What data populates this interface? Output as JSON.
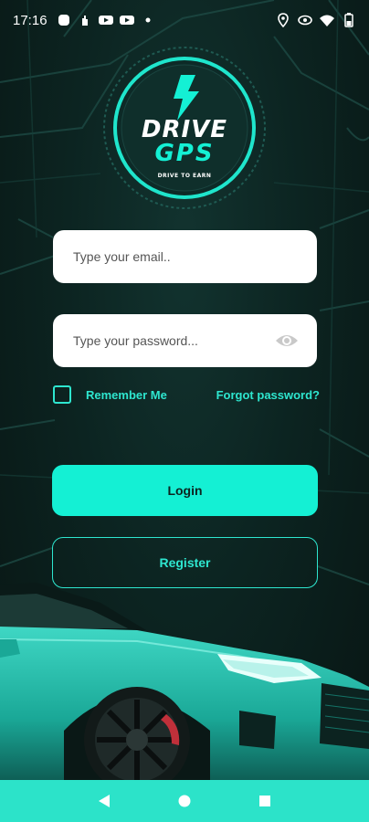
{
  "status_bar": {
    "time": "17:16",
    "left_icons": [
      "circle-icon",
      "hand-icon",
      "youtube-icon",
      "youtube-icon",
      "dot-icon"
    ],
    "right_icons": [
      "location-icon",
      "eye-icon",
      "wifi-icon",
      "battery-icon"
    ]
  },
  "logo": {
    "line1": "DRIVE",
    "line2": "GPS",
    "tagline": "DRIVE TO EARN",
    "icon": "lightning-bolt-icon"
  },
  "form": {
    "email_placeholder": "Type your email..",
    "password_placeholder": "Type your password...",
    "remember_label": "Remember Me",
    "forgot_label": "Forgot password?"
  },
  "buttons": {
    "login_label": "Login",
    "register_label": "Register"
  },
  "nav": {
    "back": "back-icon",
    "home": "home-icon",
    "recents": "recents-icon"
  },
  "colors": {
    "accent": "#14f0d4",
    "accent_text": "#2ee6cf",
    "background": "#0c2421",
    "nav_bar": "#2ce3c9"
  }
}
